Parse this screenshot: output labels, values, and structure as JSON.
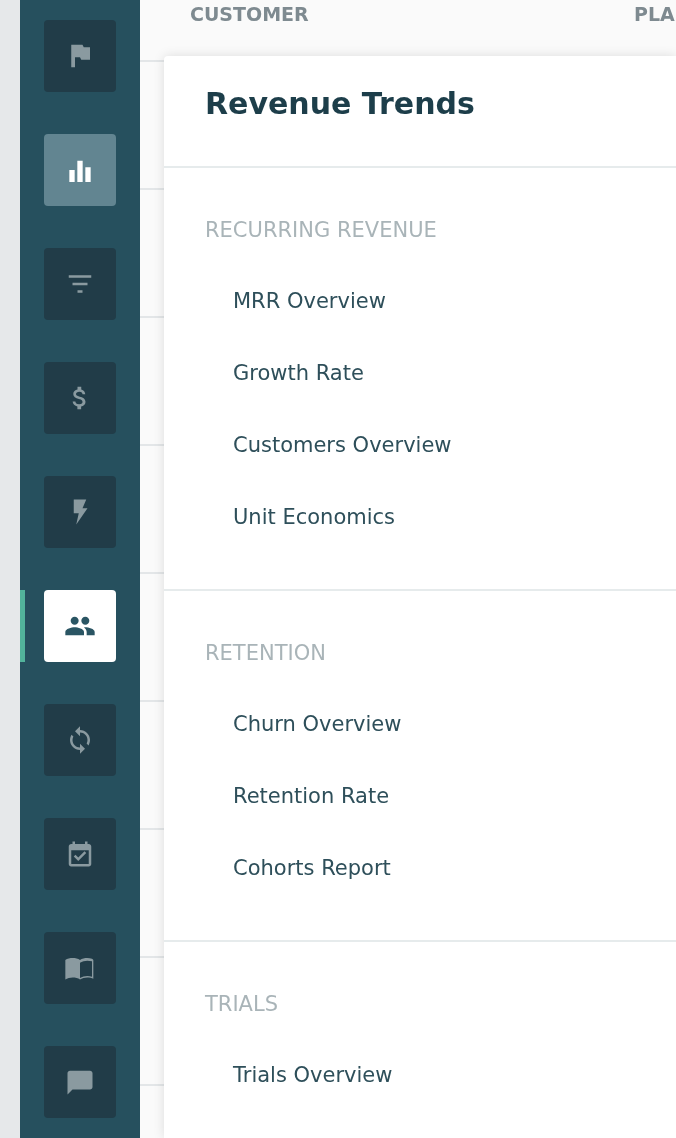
{
  "table": {
    "columns": [
      "CUSTOMER",
      "PLA"
    ]
  },
  "nav": [
    {
      "selected": false,
      "hovered": false
    },
    {
      "selected": false,
      "hovered": true
    },
    {
      "selected": false,
      "hovered": false
    },
    {
      "selected": false,
      "hovered": false
    },
    {
      "selected": false,
      "hovered": false
    },
    {
      "selected": true,
      "hovered": false
    },
    {
      "selected": false,
      "hovered": false
    },
    {
      "selected": false,
      "hovered": false
    },
    {
      "selected": false,
      "hovered": false
    },
    {
      "selected": false,
      "hovered": false
    }
  ],
  "panel": {
    "title": "Revenue Trends",
    "sections": [
      {
        "heading": "RECURRING REVENUE",
        "items": [
          "MRR Overview",
          "Growth Rate",
          "Customers Overview",
          "Unit Economics"
        ]
      },
      {
        "heading": "RETENTION",
        "items": [
          "Churn Overview",
          "Retention Rate",
          "Cohorts Report"
        ]
      },
      {
        "heading": "TRIALS",
        "items": [
          "Trials Overview"
        ]
      }
    ]
  }
}
